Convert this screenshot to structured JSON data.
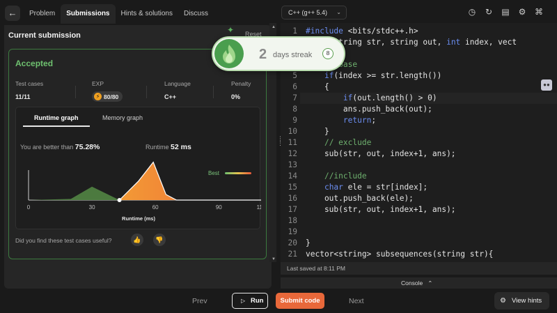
{
  "topbar": {
    "back_icon": "arrow-left-icon",
    "tabs": [
      {
        "label": "Problem",
        "active": false
      },
      {
        "label": "Submissions",
        "active": true
      },
      {
        "label": "Hints & solutions",
        "active": false
      },
      {
        "label": "Discuss",
        "active": false
      }
    ],
    "language": "C++ (g++ 5.4)",
    "icons": [
      "timer-icon",
      "refresh-icon",
      "bookmark-icon",
      "settings-icon",
      "fullscreen-icon"
    ]
  },
  "submission": {
    "heading": "Current submission",
    "status": "Accepted",
    "status_meta": "A",
    "stats": {
      "test_cases_label": "Test cases",
      "test_cases_value": "11/11",
      "exp_label": "EXP",
      "exp_value": "80/80",
      "language_label": "Language",
      "language_value": "C++",
      "penalty_label": "Penalty",
      "penalty_value": "0%"
    },
    "graph": {
      "tabs": [
        "Runtime graph",
        "Memory graph"
      ],
      "better_prefix": "You are better than",
      "better_value": "75.28%",
      "runtime_label": "Runtime",
      "runtime_value": "52 ms",
      "best_label": "Best"
    },
    "feedback_question": "Did you find these test cases useful?"
  },
  "chart_data": {
    "type": "area",
    "xlabel": "Runtime (ms)",
    "ylabel": "",
    "xlim": [
      0,
      110
    ],
    "x_ticks": [
      0,
      30,
      60,
      90,
      110
    ],
    "series": [
      {
        "values_x": [
          0,
          20,
          30,
          43
        ],
        "values_y": [
          0,
          1,
          12,
          0
        ]
      },
      {
        "values_x": [
          43,
          52,
          59,
          65,
          70,
          110
        ],
        "values_y": [
          0,
          17,
          34,
          5,
          0,
          0
        ]
      }
    ],
    "marker_x": 43,
    "colors": {
      "green": "#4c7a3f",
      "orange": "#f08a30",
      "peak": "#f6c27a"
    }
  },
  "editor": {
    "lines": [
      {
        "n": "1",
        "html": "<span class='kw'>#include</span> &lt;bits/stdc++.h&gt;"
      },
      {
        "n": "2",
        "html": "  sub(string str, string out, <span class='kw'>int</span> index, vect"
      },
      {
        "n": "3",
        "html": ""
      },
      {
        "n": "4",
        "html": "    <span class='cm'>// base</span>"
      },
      {
        "n": "5",
        "html": "    <span class='kw'>if</span>(index &gt;= str.length())"
      },
      {
        "n": "6",
        "html": "    {"
      },
      {
        "n": "7",
        "html": "        <span class='kw'>if</span>(out.length() &gt; 0)"
      },
      {
        "n": "8",
        "html": "        ans.push_back(out);"
      },
      {
        "n": "9",
        "html": "        <span class='kw'>return</span>;"
      },
      {
        "n": "10",
        "html": "    }"
      },
      {
        "n": "11",
        "html": "    <span class='cm'>// exclude</span>"
      },
      {
        "n": "12",
        "html": "    sub(str, out, index+1, ans);"
      },
      {
        "n": "13",
        "html": ""
      },
      {
        "n": "14",
        "html": "    <span class='cm'>//include</span>"
      },
      {
        "n": "15",
        "html": "    <span class='kw'>char</span> ele = str[index];"
      },
      {
        "n": "16",
        "html": "    out.push_back(ele);"
      },
      {
        "n": "17",
        "html": "    sub(str, out, index+1, ans);"
      },
      {
        "n": "18",
        "html": ""
      },
      {
        "n": "19",
        "html": ""
      },
      {
        "n": "20",
        "html": "}"
      },
      {
        "n": "21",
        "html": "vector&lt;string&gt; subsequences(string str){"
      }
    ],
    "last_saved": "Last saved at 8:11 PM",
    "console_label": "Console"
  },
  "bottombar": {
    "prev": "Prev",
    "run": "Run",
    "submit": "Submit code",
    "next": "Next",
    "hints": "View hints"
  },
  "streak": {
    "count": "2",
    "label": "days streak",
    "badge": "8",
    "peek_text": "Reset"
  }
}
